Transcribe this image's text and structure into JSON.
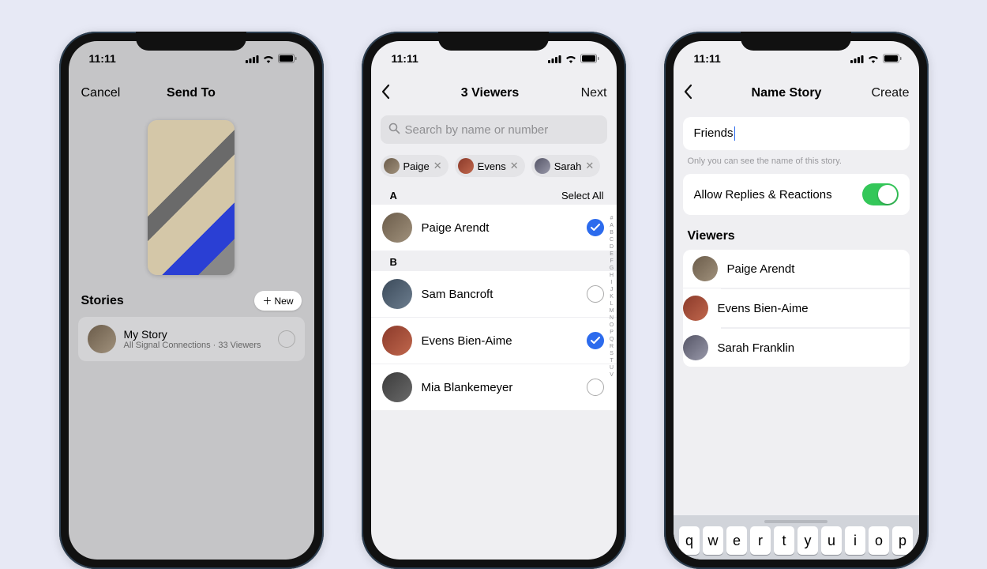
{
  "status": {
    "time": "11:11"
  },
  "screen1": {
    "nav": {
      "left": "Cancel",
      "title": "Send To"
    },
    "stories_header": "Stories",
    "new_button": "New",
    "my_story": {
      "title": "My Story",
      "subtitle": "All Signal Connections · 33 Viewers"
    }
  },
  "screen2": {
    "nav": {
      "title": "3 Viewers",
      "next": "Next"
    },
    "search_placeholder": "Search by name or number",
    "chips": [
      {
        "name": "Paige"
      },
      {
        "name": "Evens"
      },
      {
        "name": "Sarah"
      }
    ],
    "select_all": "Select All",
    "sections": [
      {
        "letter": "A",
        "contacts": [
          {
            "name": "Paige Arendt",
            "checked": true,
            "avatar": "av-a"
          }
        ]
      },
      {
        "letter": "B",
        "contacts": [
          {
            "name": "Sam Bancroft",
            "checked": false,
            "avatar": "av-d"
          },
          {
            "name": "Evens Bien-Aime",
            "checked": true,
            "avatar": "av-e"
          },
          {
            "name": "Mia Blankemeyer",
            "checked": false,
            "avatar": "av-f"
          }
        ]
      }
    ],
    "index": [
      "#",
      "A",
      "B",
      "C",
      "D",
      "E",
      "F",
      "G",
      "H",
      "I",
      "J",
      "K",
      "L",
      "M",
      "N",
      "O",
      "P",
      "Q",
      "R",
      "S",
      "T",
      "U",
      "V"
    ]
  },
  "screen3": {
    "nav": {
      "title": "Name Story",
      "action": "Create"
    },
    "name_value": "Friends",
    "hint": "Only you can see the name of this story.",
    "setting_label": "Allow Replies & Reactions",
    "viewers_header": "Viewers",
    "viewers": [
      {
        "name": "Paige Arendt",
        "avatar": "av-a"
      },
      {
        "name": "Evens Bien-Aime",
        "avatar": "av-e"
      },
      {
        "name": "Sarah Franklin",
        "avatar": "av-c"
      }
    ],
    "keys": [
      "q",
      "w",
      "e",
      "r",
      "t",
      "y",
      "u",
      "i",
      "o",
      "p"
    ]
  }
}
